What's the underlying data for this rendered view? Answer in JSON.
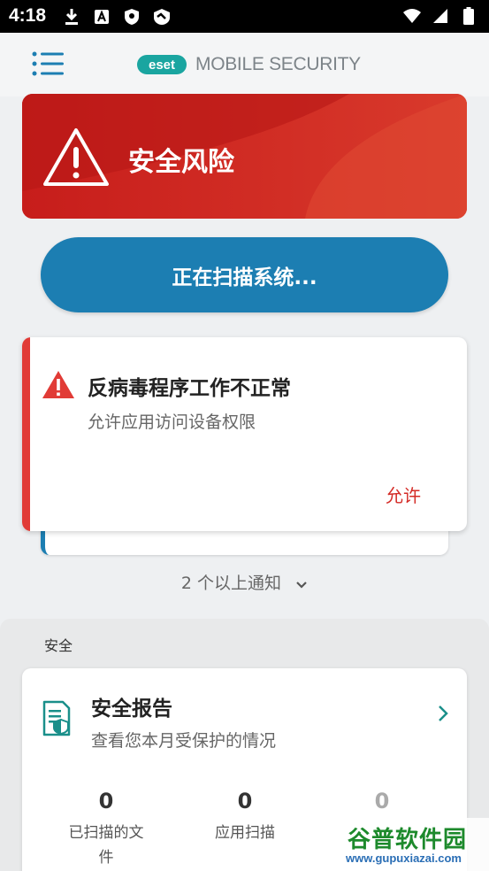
{
  "status_bar": {
    "time": "4:18"
  },
  "app_bar": {
    "brand_title": "MOBILE SECURITY",
    "logo_text": "eset"
  },
  "risk_banner": {
    "title": "安全风险"
  },
  "scan_button": {
    "label": "正在扫描系统..."
  },
  "notification": {
    "title": "反病毒程序工作不正常",
    "subtitle": "允许应用访问设备权限",
    "action_label": "允许"
  },
  "more_notifications": {
    "label": "2 个以上通知"
  },
  "section": {
    "label": "安全"
  },
  "security_report": {
    "title": "安全报告",
    "subtitle": "查看您本月受保护的情况",
    "stats": [
      {
        "value": "0",
        "label": "已扫描的文件"
      },
      {
        "value": "0",
        "label": "应用扫描"
      },
      {
        "value": "0",
        "label": ""
      }
    ]
  },
  "watermark": {
    "title": "谷普软件园",
    "url": "www.gupuxiazai.com"
  },
  "colors": {
    "risk_red": "#c41c1a",
    "accent_blue": "#1c7eb2",
    "warning_red": "#e13b36"
  }
}
